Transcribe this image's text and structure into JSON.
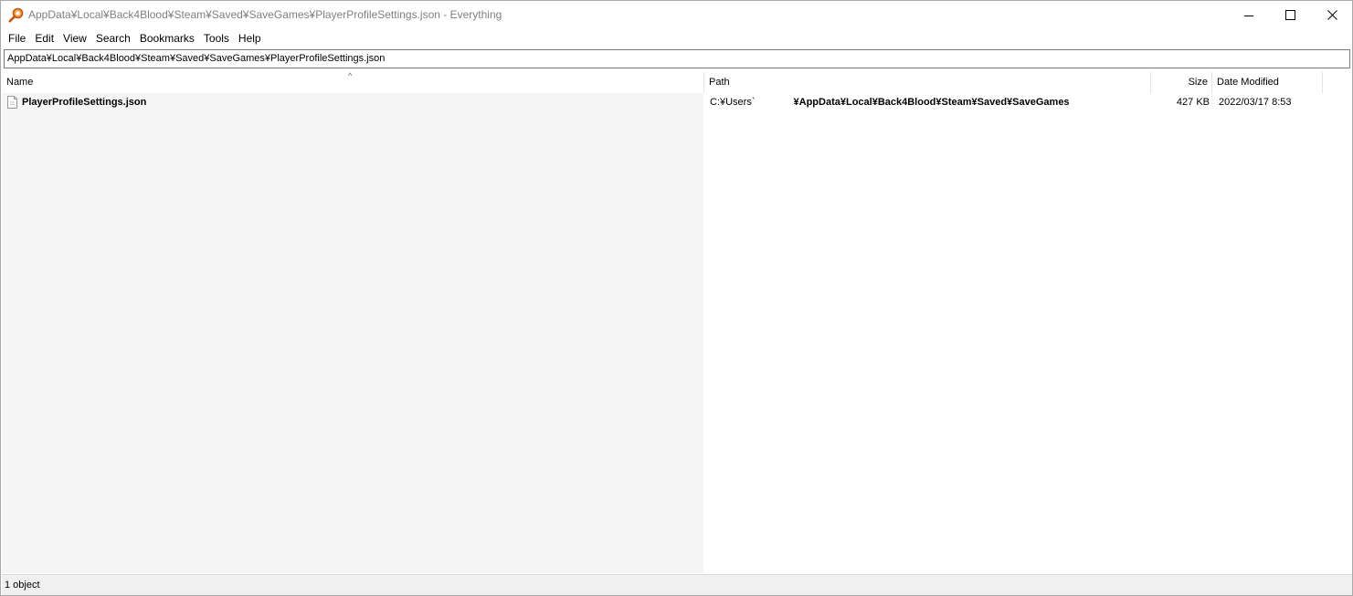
{
  "window": {
    "title": "AppData¥Local¥Back4Blood¥Steam¥Saved¥SaveGames¥PlayerProfileSettings.json - Everything",
    "app_icon": "everything-magnifier-icon"
  },
  "menu": {
    "items": [
      {
        "label": "File"
      },
      {
        "label": "Edit"
      },
      {
        "label": "View"
      },
      {
        "label": "Search"
      },
      {
        "label": "Bookmarks"
      },
      {
        "label": "Tools"
      },
      {
        "label": "Help"
      }
    ]
  },
  "search": {
    "value": "AppData¥Local¥Back4Blood¥Steam¥Saved¥SaveGames¥PlayerProfileSettings.json"
  },
  "columns": {
    "name": "Name",
    "path": "Path",
    "size": "Size",
    "date": "Date Modified"
  },
  "rows": [
    {
      "name": "PlayerProfileSettings.json",
      "path_prefix": "C:¥Users`",
      "path_suffix": "¥AppData¥Local¥Back4Blood¥Steam¥Saved¥SaveGames",
      "size": "427 KB",
      "date": "2022/03/17 8:53"
    }
  ],
  "status": {
    "text": "1 object"
  },
  "colors": {
    "accent": "#e87a1e",
    "name_column_bg": "#f5f5f5",
    "statusbar_bg": "#f0f0f0"
  }
}
